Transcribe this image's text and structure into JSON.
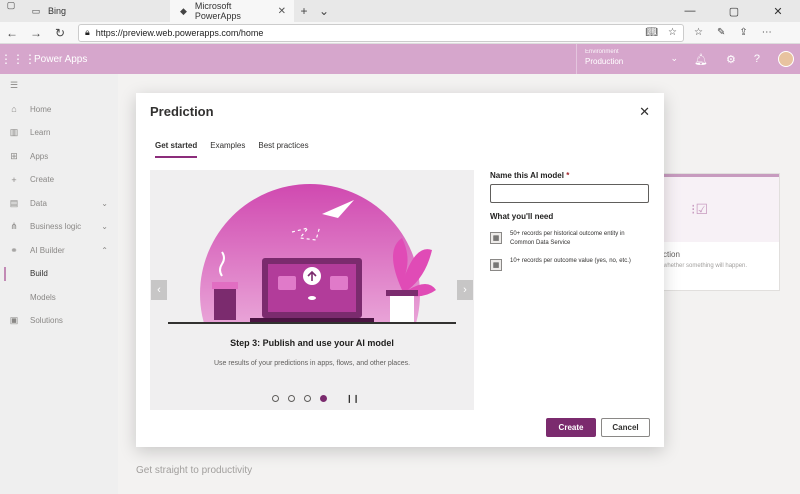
{
  "browser": {
    "tabs": [
      {
        "label": "Bing",
        "active": false
      },
      {
        "label": "Microsoft PowerApps",
        "active": true
      }
    ],
    "new_tab": "+",
    "url": "https://preview.web.powerapps.com/home"
  },
  "header": {
    "app_title": "Power Apps",
    "environment_label": "Environment",
    "environment_value": "Production"
  },
  "sidebar": {
    "items": [
      {
        "label": "Home",
        "icon": "home-icon"
      },
      {
        "label": "Learn",
        "icon": "book-icon"
      },
      {
        "label": "Apps",
        "icon": "apps-icon"
      },
      {
        "label": "Create",
        "icon": "plus-icon"
      },
      {
        "label": "Data",
        "icon": "database-icon",
        "expandable": true
      },
      {
        "label": "Business logic",
        "icon": "flow-icon",
        "expandable": true
      },
      {
        "label": "AI Builder",
        "icon": "ai-icon",
        "expandable": true,
        "expanded": true
      },
      {
        "label": "Build",
        "sub": true,
        "active": true
      },
      {
        "label": "Models",
        "sub": true
      },
      {
        "label": "Solutions",
        "icon": "solutions-icon"
      }
    ]
  },
  "background": {
    "card_title": "ction",
    "card_desc": "whether something will happen.",
    "section_title": "Get straight to productivity"
  },
  "modal": {
    "title": "Prediction",
    "tabs": [
      "Get started",
      "Examples",
      "Best practices"
    ],
    "active_tab": "Get started",
    "carousel": {
      "step_title": "Step 3: Publish and use your AI model",
      "step_desc": "Use results of your predictions in apps, flows, and other places.",
      "slide_count": 4,
      "current_slide": 4
    },
    "form": {
      "name_label": "Name this AI model",
      "required_mark": "*",
      "name_value": "",
      "needs_title": "What you'll need",
      "needs": [
        "50+ records per historical outcome entity in Common Data Service",
        "10+ records per outcome value (yes, no, etc.)"
      ]
    },
    "buttons": {
      "create": "Create",
      "cancel": "Cancel"
    }
  },
  "colors": {
    "header": "#d6a6cc",
    "accent": "#7b2b6e",
    "illustration": "#c63ca7"
  }
}
